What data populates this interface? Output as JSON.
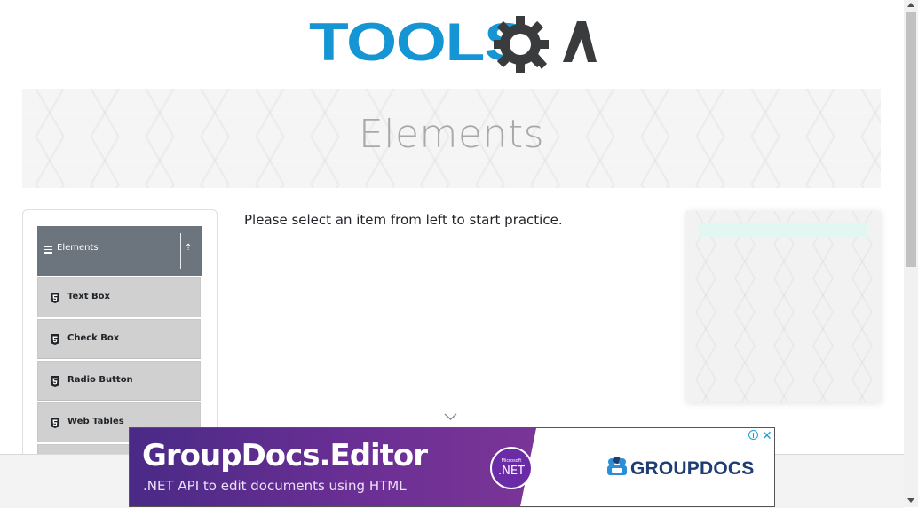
{
  "logo": {
    "part1": "TOOLS",
    "part2": "QA",
    "colors": {
      "tools": "#1595d3",
      "qa": "#3a3b3d"
    }
  },
  "banner": {
    "title": "Elements"
  },
  "sidebar": {
    "group_label": "Elements",
    "items": [
      {
        "label": "Text Box",
        "icon": "html5-icon"
      },
      {
        "label": "Check Box",
        "icon": "html5-icon"
      },
      {
        "label": "Radio Button",
        "icon": "html5-icon"
      },
      {
        "label": "Web Tables",
        "icon": "html5-icon"
      }
    ]
  },
  "main": {
    "prompt": "Please select an item from left to start practice."
  },
  "ad": {
    "title": "GroupDocs.Editor",
    "subtitle": ".NET API to edit documents using HTML",
    "badge_small": "Microsoft",
    "badge_big": ".NET",
    "brand": "GROUPDOCS",
    "info": "i",
    "close": "✕"
  }
}
